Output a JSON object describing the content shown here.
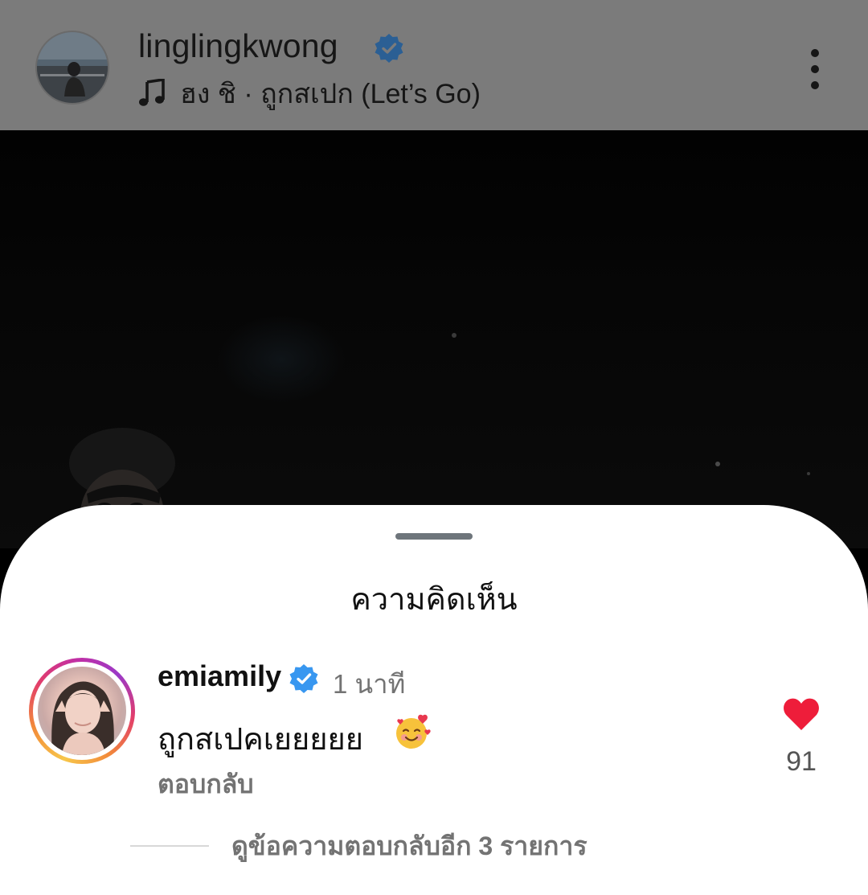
{
  "header": {
    "username": "linglingkwong",
    "song": "ฮง ชิ · ถูกสเปก (Let’s Go)",
    "icons": [
      "verified-badge-icon",
      "music-note-icon",
      "more-options-icon"
    ]
  },
  "sheet": {
    "title": "ความคิดเห็น"
  },
  "comment": {
    "username": "emiamily",
    "time": "1 นาที",
    "text": "ถูกสเปคเยยยยย",
    "emoji": "smiling-face-with-hearts",
    "reply_label": "ตอบกลับ",
    "like_count": "91",
    "like_color": "#ee1d3a"
  },
  "view_more_replies": "ดูข้อความตอบกลับอีก 3 รายการ",
  "colors": {
    "verified": "#3897f0",
    "header_bg": "#7b7b7b",
    "sheet_bg": "#ffffff"
  }
}
